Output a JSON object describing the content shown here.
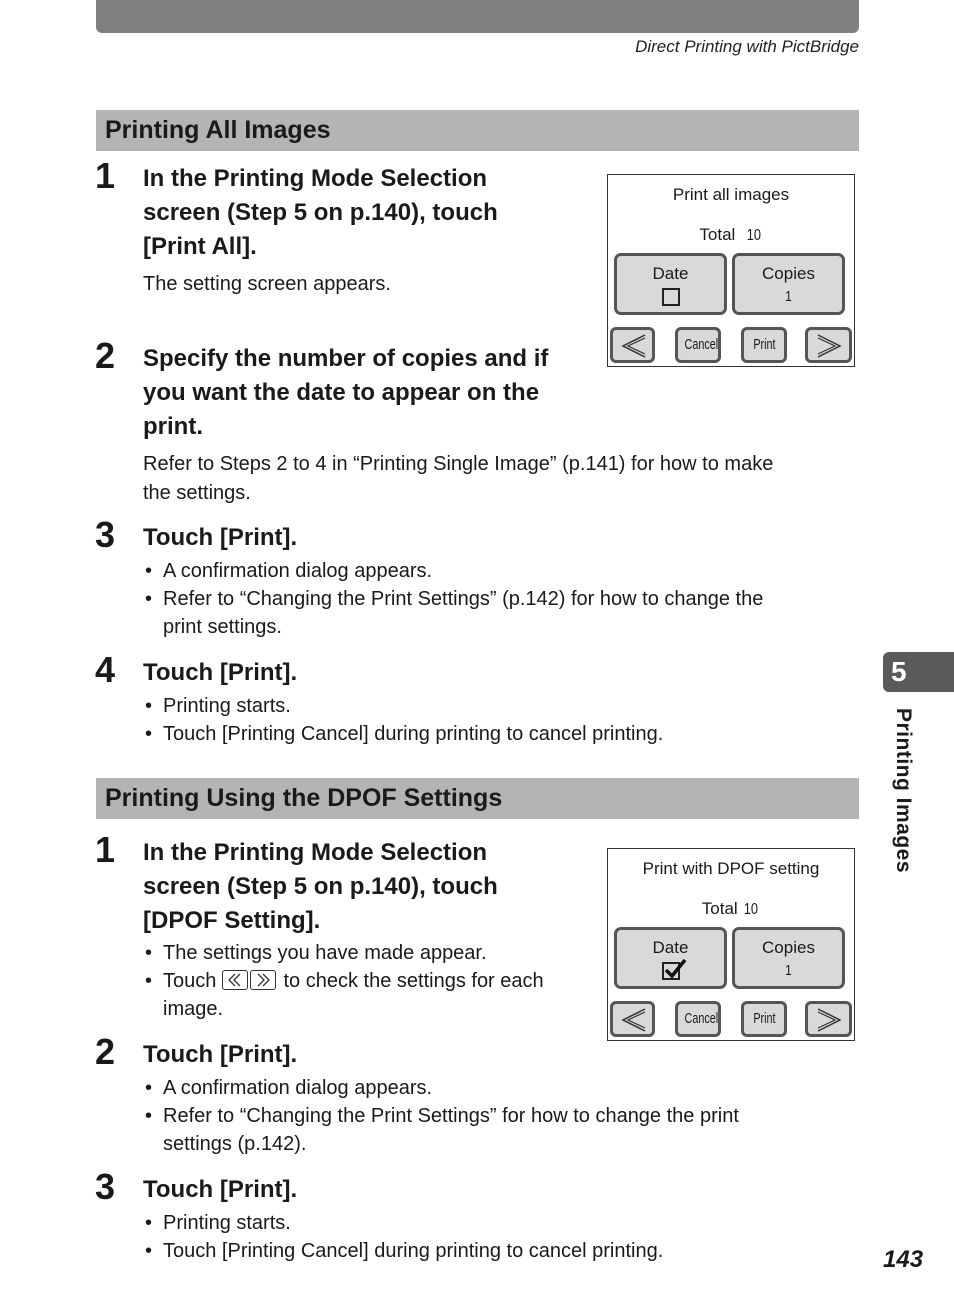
{
  "header": {
    "running_title": "Direct Printing with PictBridge"
  },
  "sections": [
    {
      "heading": "Printing All Images",
      "steps": [
        {
          "num": "1",
          "title_lines": [
            "In the Printing Mode Selection",
            "screen (Step 5 on p.140), touch",
            "[Print All]."
          ],
          "body": "The setting screen appears."
        },
        {
          "num": "2",
          "title_lines": [
            "Specify the number of copies and if",
            "you want the date to appear on the",
            "print."
          ],
          "body_lines": [
            "Refer to Steps 2 to 4 in “Printing Single Image” (p.141) for how to make",
            "the settings."
          ]
        },
        {
          "num": "3",
          "title": "Touch [Print].",
          "bullets": [
            "A confirmation dialog appears.",
            "Refer to “Changing the Print Settings” (p.142) for how to change the",
            "print settings."
          ]
        },
        {
          "num": "4",
          "title": "Touch [Print].",
          "bullets": [
            "Printing starts.",
            "Touch [Printing Cancel] during printing to cancel printing."
          ]
        }
      ],
      "screen": {
        "title": "Print all images",
        "total_label": "Total",
        "total_value": "10",
        "date_label": "Date",
        "date_checked": false,
        "copies_label": "Copies",
        "copies_value": "1",
        "cancel_label": "Cancel",
        "print_label": "Print"
      }
    },
    {
      "heading": "Printing Using the DPOF Settings",
      "steps": [
        {
          "num": "1",
          "title_lines": [
            "In the Printing Mode Selection",
            "screen (Step 5 on p.140), touch",
            "[DPOF Setting]."
          ],
          "bullets": [
            "The settings you have made appear.",
            "Touch",
            "to check the settings for each",
            "image."
          ]
        },
        {
          "num": "2",
          "title": "Touch [Print].",
          "bullets": [
            "A confirmation dialog appears.",
            "Refer to “Changing the Print Settings” for how to change the print",
            "settings (p.142)."
          ]
        },
        {
          "num": "3",
          "title": "Touch [Print].",
          "bullets": [
            "Printing starts.",
            "Touch [Printing Cancel] during printing to cancel printing."
          ]
        }
      ],
      "screen": {
        "title": "Print with DPOF setting",
        "total_label": "Total",
        "total_value": "10",
        "date_label": "Date",
        "date_checked": true,
        "copies_label": "Copies",
        "copies_value": "1",
        "cancel_label": "Cancel",
        "print_label": "Print"
      }
    }
  ],
  "chapter": {
    "number": "5",
    "label": "Printing Images"
  },
  "page_number": "143"
}
